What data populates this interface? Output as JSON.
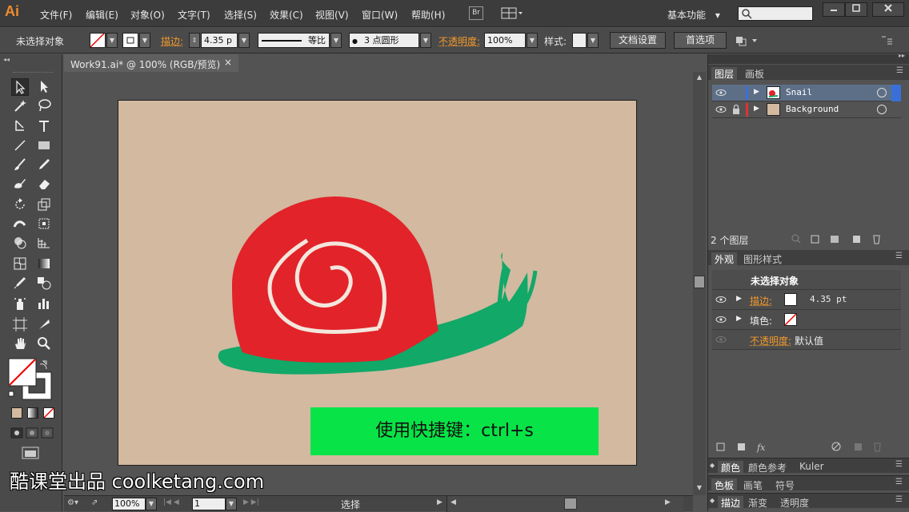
{
  "app": {
    "logo": "Ai"
  },
  "menu": [
    "文件(F)",
    "编辑(E)",
    "对象(O)",
    "文字(T)",
    "选择(S)",
    "效果(C)",
    "视图(V)",
    "窗口(W)",
    "帮助(H)"
  ],
  "topbar": {
    "bridge": "Br",
    "workspace": "基本功能",
    "workspace_arrow": "▾"
  },
  "control": {
    "selection": "未选择对象",
    "stroke_label": "描边",
    "stroke_value": "4.35 p",
    "profile_label": "等比",
    "brush_label": "3 点圆形",
    "opacity_label": "不透明度",
    "opacity_value": "100%",
    "style_label": "样式",
    "doc_setup": "文档设置",
    "prefs": "首选项"
  },
  "document": {
    "tab_title": "Work91.ai* @ 100% (RGB/预览)",
    "close": "×"
  },
  "layers_panel": {
    "tabs": [
      "图层",
      "画板"
    ],
    "layers": [
      {
        "name": "Snail",
        "color": "#3b6fd8",
        "selected": true
      },
      {
        "name": "Background",
        "color": "#e03232",
        "selected": false
      }
    ],
    "footer": "2 个图层"
  },
  "appearance_panel": {
    "tabs": [
      "外观",
      "图形样式"
    ],
    "title": "未选择对象",
    "stroke_label": "描边",
    "stroke_value": "4.35 pt",
    "fill_label": "填色",
    "opacity_label": "不透明度",
    "opacity_value": "默认值"
  },
  "bottom_panels": [
    {
      "tabs": [
        "颜色",
        "颜色参考",
        "Kuler"
      ]
    },
    {
      "tabs": [
        "色板",
        "画笔",
        "符号"
      ]
    },
    {
      "tabs": [
        "描边",
        "渐变",
        "透明度"
      ]
    }
  ],
  "statusbar": {
    "zoom": "100%",
    "page": "1",
    "mode": "选择"
  },
  "caption": "使用快捷键：ctrl+s",
  "watermark": "酷课堂出品 coolketang.com",
  "colors": {
    "snail_shell": "#e2232a",
    "snail_body": "#11a868",
    "artboard": "#d2b9a0",
    "caption_bg": "#08e447",
    "accent_orange": "#f39a2b"
  }
}
